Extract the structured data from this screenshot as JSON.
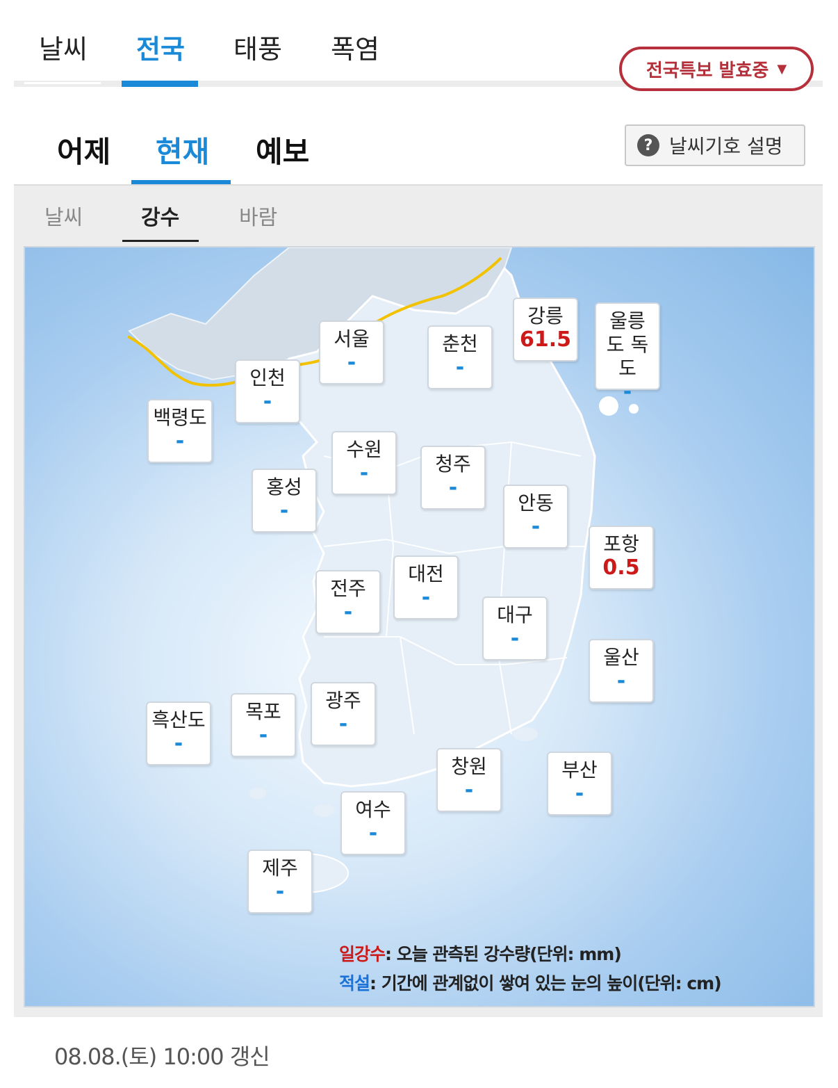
{
  "top_tabs": [
    {
      "label": "날씨",
      "active": false
    },
    {
      "label": "전국",
      "active": true
    },
    {
      "label": "태풍",
      "active": false
    },
    {
      "label": "폭염",
      "active": false
    }
  ],
  "warning_button": {
    "label": "전국특보 발효중",
    "icon": "caret-down-icon"
  },
  "sub_tabs": [
    {
      "label": "어제",
      "active": false
    },
    {
      "label": "현재",
      "active": true
    },
    {
      "label": "예보",
      "active": false
    }
  ],
  "legend_button": {
    "label": "날씨기호 설명",
    "icon": "question-icon"
  },
  "tertiary_tabs": [
    {
      "label": "날씨",
      "active": false
    },
    {
      "label": "강수",
      "active": true
    },
    {
      "label": "바람",
      "active": false
    }
  ],
  "cities": [
    {
      "name": "서울",
      "value": "-"
    },
    {
      "name": "춘천",
      "value": "-"
    },
    {
      "name": "강릉",
      "value": "61.5"
    },
    {
      "name": "울릉도 독도",
      "value": "-"
    },
    {
      "name": "인천",
      "value": "-"
    },
    {
      "name": "백령도",
      "value": "-"
    },
    {
      "name": "수원",
      "value": "-"
    },
    {
      "name": "청주",
      "value": "-"
    },
    {
      "name": "홍성",
      "value": "-"
    },
    {
      "name": "안동",
      "value": "-"
    },
    {
      "name": "포항",
      "value": "0.5"
    },
    {
      "name": "대전",
      "value": "-"
    },
    {
      "name": "전주",
      "value": "-"
    },
    {
      "name": "대구",
      "value": "-"
    },
    {
      "name": "울산",
      "value": "-"
    },
    {
      "name": "흑산도",
      "value": "-"
    },
    {
      "name": "목포",
      "value": "-"
    },
    {
      "name": "광주",
      "value": "-"
    },
    {
      "name": "창원",
      "value": "-"
    },
    {
      "name": "부산",
      "value": "-"
    },
    {
      "name": "여수",
      "value": "-"
    },
    {
      "name": "제주",
      "value": "-"
    }
  ],
  "map_legend": {
    "rain_term": "일강수",
    "rain_desc": ": 오늘 관측된 강수량(단위: mm)",
    "snow_term": "적설",
    "snow_desc": ": 기간에 관계없이 쌓여 있는 눈의 높이(단위: cm)"
  },
  "update_text": "08.08.(토) 10:00 갱신",
  "colors": {
    "accent": "#1a8ad8",
    "warning": "#b5303a",
    "rain_value": "#cc1a1a",
    "front_line": "#f2c200"
  }
}
